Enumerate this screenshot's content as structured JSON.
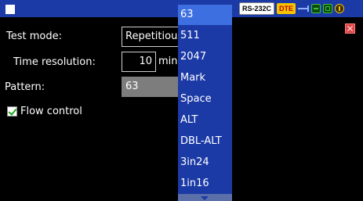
{
  "status_bar": {
    "rs_badge": "RS-232C",
    "dte_badge": "DTE"
  },
  "form": {
    "test_mode_label": "Test mode:",
    "test_mode_value": "Repetitious",
    "time_resolution_label": "Time resolution:",
    "time_resolution_value": "10",
    "time_resolution_unit": "min.",
    "pattern_label": "Pattern:",
    "pattern_value": "63",
    "flow_control_label": "Flow control",
    "flow_control_checked": true
  },
  "dropdown": {
    "selected_index": 0,
    "options": [
      "63",
      "511",
      "2047",
      "Mark",
      "Space",
      "ALT",
      "DBL-ALT",
      "3in24",
      "1in16"
    ]
  },
  "icons": [
    "window-icon",
    "usb-icon",
    "lan-icon",
    "sd-card-icon",
    "power-icon",
    "close-icon",
    "checkmark-icon",
    "scroll-down-icon"
  ],
  "colors": {
    "header": "#1c3aa6",
    "selected": "#3d6fe0",
    "dte_badge": "#f4c400",
    "check": "#1aa51a",
    "close": "#e04444"
  }
}
